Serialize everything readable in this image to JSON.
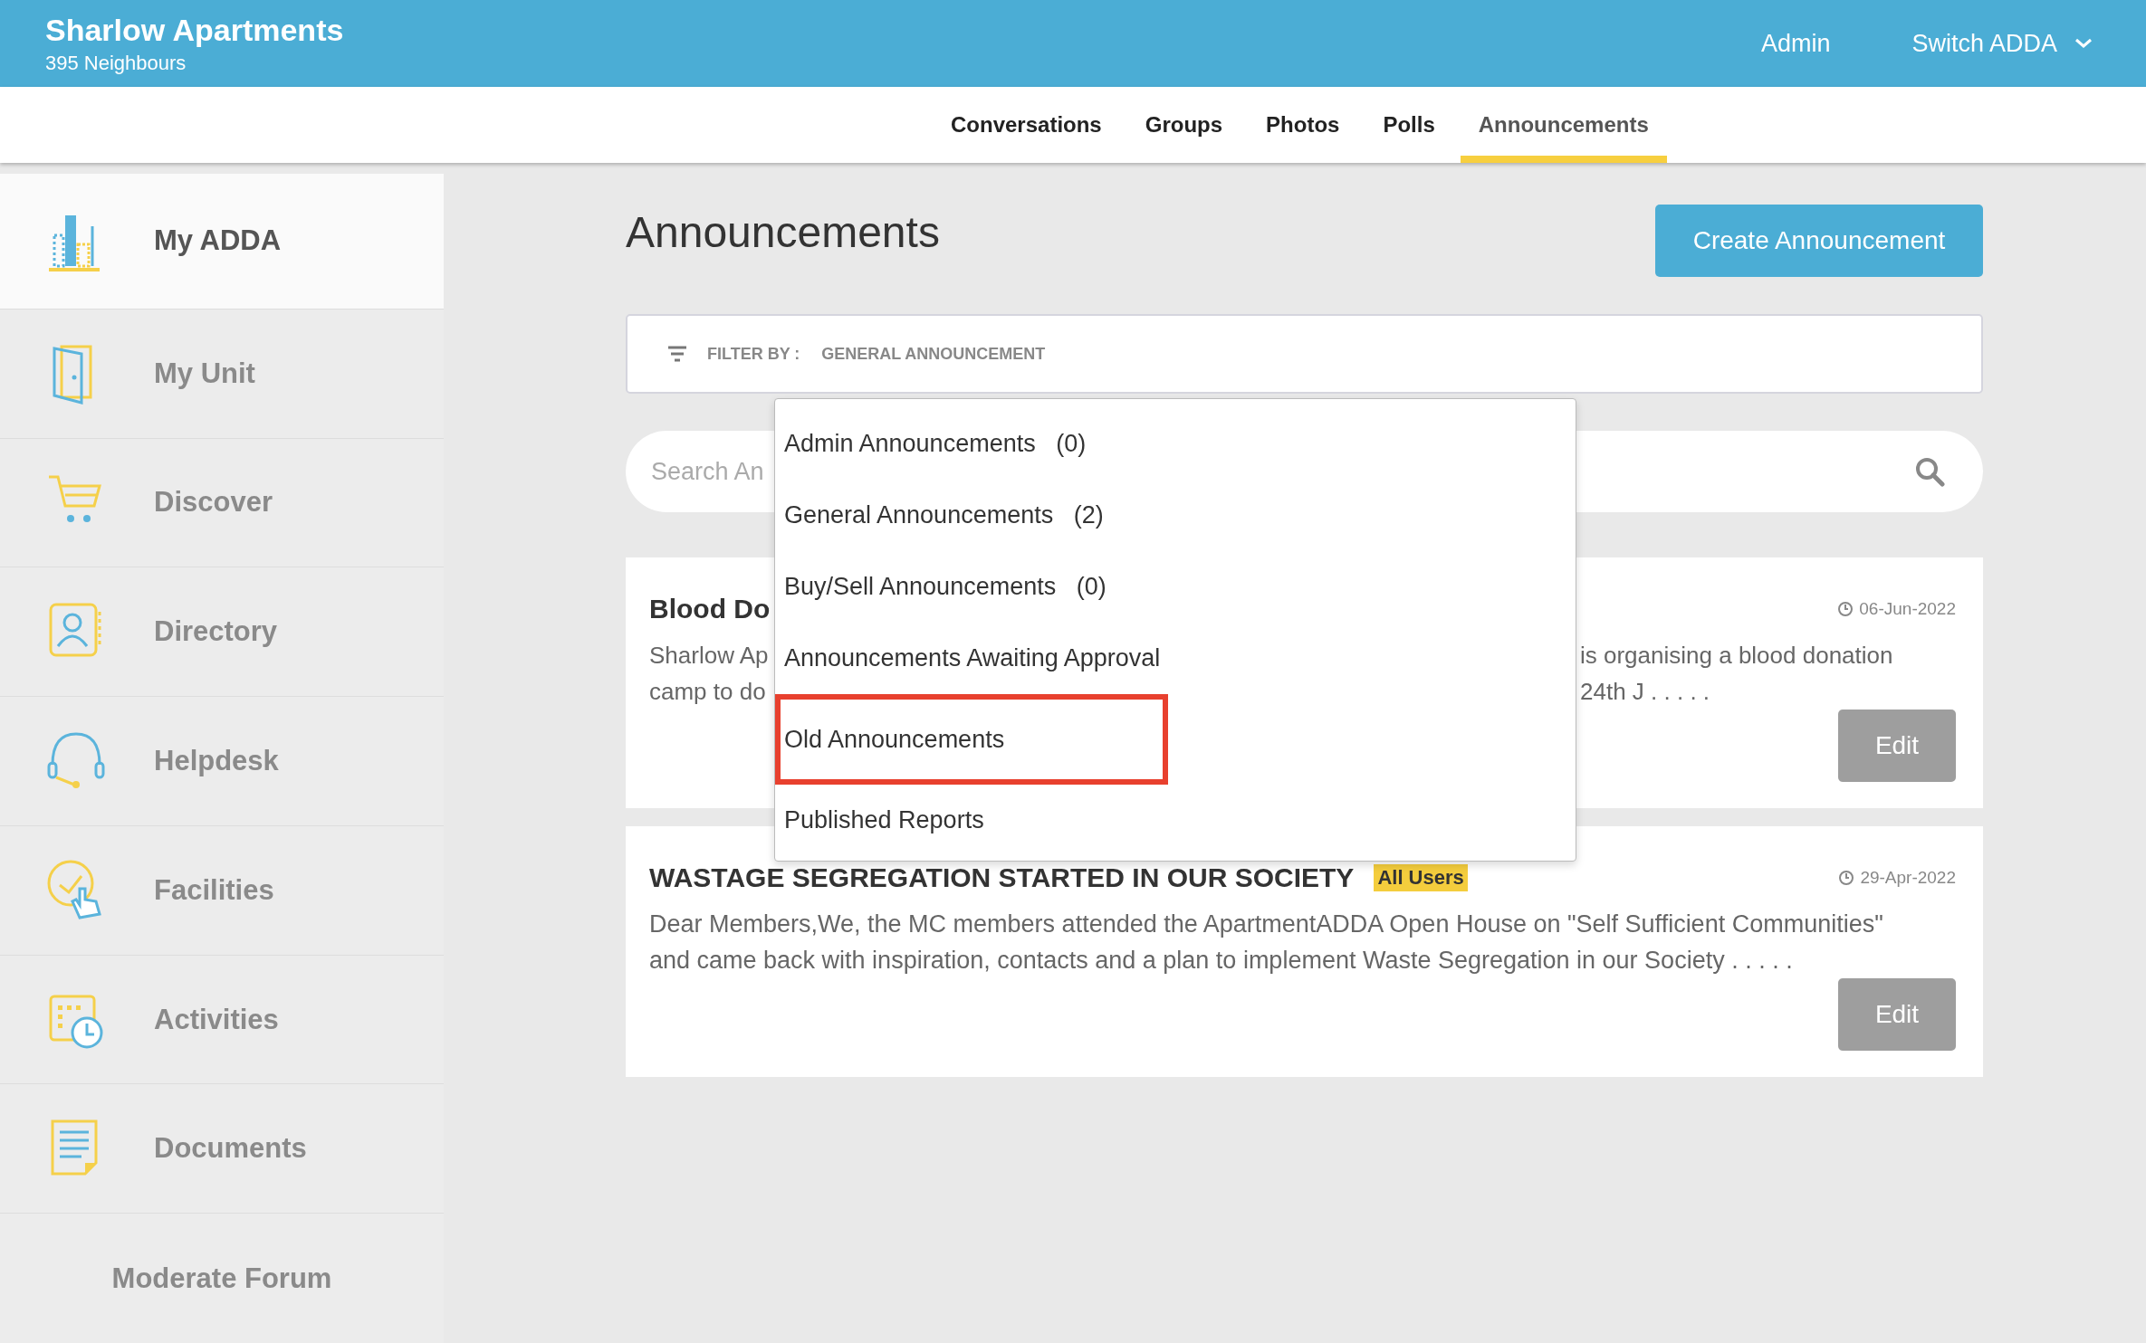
{
  "header": {
    "title": "Sharlow Apartments",
    "subtitle": "395 Neighbours",
    "links": [
      {
        "label": "Admin",
        "kind": "link"
      },
      {
        "label": "Switch ADDA",
        "kind": "menu"
      }
    ]
  },
  "tabs": [
    {
      "label": "Conversations",
      "selected": false
    },
    {
      "label": "Groups",
      "selected": false
    },
    {
      "label": "Photos",
      "selected": false
    },
    {
      "label": "Polls",
      "selected": false
    },
    {
      "label": "Announcements",
      "selected": true
    }
  ],
  "sidebar": {
    "items": [
      {
        "label": "My ADDA",
        "selected": true
      },
      {
        "label": "My Unit",
        "selected": false
      },
      {
        "label": "Discover",
        "selected": false
      },
      {
        "label": "Directory",
        "selected": false
      },
      {
        "label": "Helpdesk",
        "selected": false
      },
      {
        "label": "Facilities",
        "selected": false
      },
      {
        "label": "Activities",
        "selected": false
      },
      {
        "label": "Documents",
        "selected": false
      },
      {
        "label": "Moderate Forum",
        "selected": false
      }
    ]
  },
  "page": {
    "title": "Announcements",
    "create_button": "Create Announcement"
  },
  "filter": {
    "label": "FILTER BY :",
    "value": "GENERAL ANNOUNCEMENT"
  },
  "search": {
    "placeholder": "Search An"
  },
  "dropdown": {
    "items": [
      {
        "label": "Admin Announcements",
        "count": "(0)",
        "highlighted": false
      },
      {
        "label": "General Announcements",
        "count": "(2)",
        "highlighted": false
      },
      {
        "label": "Buy/Sell Announcements",
        "count": "(0)",
        "highlighted": false
      },
      {
        "label": "Announcements Awaiting Approval",
        "highlighted": false
      },
      {
        "label": "Old Announcements",
        "highlighted": true
      },
      {
        "label": "Published Reports",
        "highlighted": false
      }
    ]
  },
  "announcements": [
    {
      "title": "Blood Do",
      "date": "06-Jun-2022",
      "lines": [
        {
          "left": "Sharlow Ap",
          "right": "is organising a blood donation"
        },
        {
          "left": "camp to do",
          "right": "24th J . . . . ."
        }
      ],
      "button": "Edit"
    },
    {
      "title": "WASTAGE SEGREGATION STARTED IN OUR SOCIETY",
      "tag": "All Users",
      "date": "29-Apr-2022",
      "lines": [
        {
          "text": "Dear Members,We, the MC members attended the ApartmentADDA Open House on \"Self Sufficient Communities\""
        },
        {
          "text": "and came back with inspiration, contacts and a plan to implement Waste Segregation in our Society . . . . ."
        }
      ],
      "button": "Edit"
    }
  ]
}
